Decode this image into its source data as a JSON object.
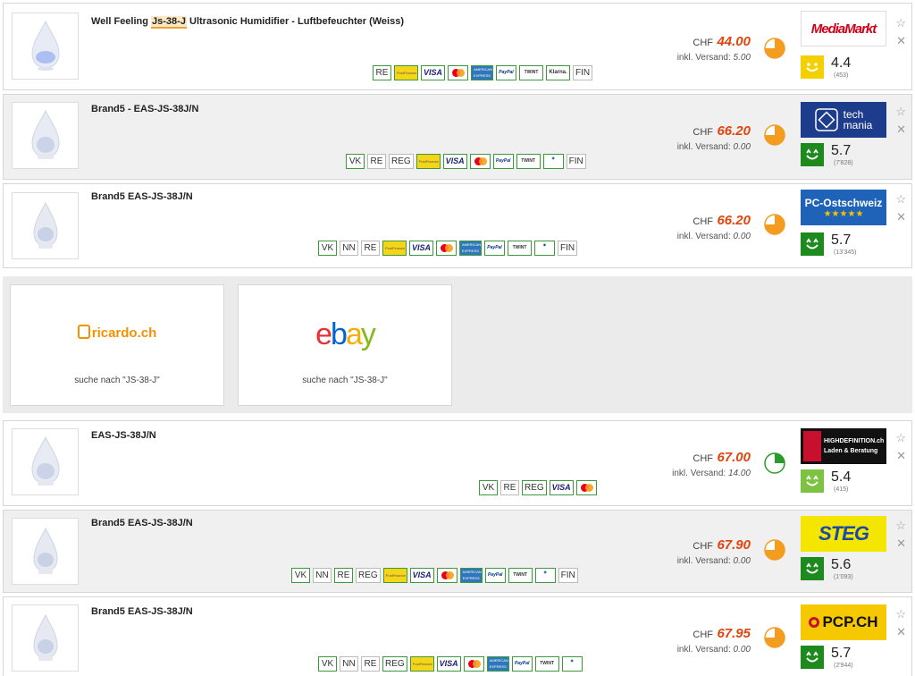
{
  "offers": [
    {
      "title_prefix": "Well Feeling ",
      "title_highlight": "Js-38-J",
      "title_suffix": " Ultrasonic Humidifier - Luftbefeuchter (Weiss)",
      "currency": "CHF",
      "price": "44.00",
      "shipping_label": "inkl. Versand:",
      "shipping": "5.00",
      "availability_icon": "availability-pie-icon",
      "badges": [
        "RE",
        "PF",
        "VISA",
        "MC",
        "AMEX",
        "PayPal",
        "TWINT",
        "Klarna.",
        "FIN"
      ],
      "shop_logo": "MediaMarkt",
      "rating": "4.4",
      "rating_count": "(453)",
      "rating_color": "#f5d000"
    },
    {
      "title": "Brand5 - EAS-JS-38J/N",
      "currency": "CHF",
      "price": "66.20",
      "shipping_label": "inkl. Versand:",
      "shipping": "0.00",
      "availability_icon": "availability-pie-icon",
      "badges": [
        "VK",
        "RE",
        "REG",
        "PF",
        "VISA",
        "MC",
        "PayPal",
        "TWINT",
        "DC",
        "FIN"
      ],
      "shop_logo_line1": "tech",
      "shop_logo_line2": "mania",
      "rating": "5.7",
      "rating_count": "(7'828)",
      "rating_color": "#1e8a1e"
    },
    {
      "title": "Brand5 EAS-JS-38J/N",
      "currency": "CHF",
      "price": "66.20",
      "shipping_label": "inkl. Versand:",
      "shipping": "0.00",
      "availability_icon": "availability-pie-icon",
      "badges": [
        "VK",
        "NN",
        "RE",
        "PF",
        "VISA",
        "MC",
        "AMEX",
        "PayPal",
        "TWINT",
        "DC",
        "FIN"
      ],
      "shop_logo": "PC-Ostschweiz",
      "shop_logo_stars": "★★★★★",
      "rating": "5.7",
      "rating_count": "(13'345)",
      "rating_color": "#1e8a1e"
    },
    {
      "title": "EAS-JS-38J/N",
      "currency": "CHF",
      "price": "67.00",
      "shipping_label": "inkl. Versand:",
      "shipping": "14.00",
      "availability_icon": "availability-pie-icon",
      "badges": [
        "VK",
        "RE",
        "REG",
        "VISA",
        "MC"
      ],
      "shop_logo_line1": "HIGHDEFINITION.ch",
      "shop_logo_line2": "Laden & Beratung",
      "rating": "5.4",
      "rating_count": "(415)",
      "rating_color": "#7dc242"
    },
    {
      "title": "Brand5 EAS-JS-38J/N",
      "currency": "CHF",
      "price": "67.90",
      "shipping_label": "inkl. Versand:",
      "shipping": "0.00",
      "availability_icon": "availability-pie-icon",
      "badges": [
        "VK",
        "NN",
        "RE",
        "REG",
        "PF",
        "VISA",
        "MC",
        "AMEX",
        "PayPal",
        "TWINT",
        "DC",
        "FIN"
      ],
      "shop_logo": "STEG",
      "rating": "5.6",
      "rating_count": "(1'093)",
      "rating_color": "#1e8a1e"
    },
    {
      "title": "Brand5 EAS-JS-38J/N",
      "currency": "CHF",
      "price": "67.95",
      "shipping_label": "inkl. Versand:",
      "shipping": "0.00",
      "availability_icon": "availability-pie-icon",
      "badges": [
        "VK",
        "NN",
        "RE",
        "REG",
        "PF",
        "VISA",
        "MC",
        "AMEX",
        "PayPal",
        "TWINT",
        "DC"
      ],
      "shop_logo": "PCP.CH",
      "rating": "5.7",
      "rating_count": "(2'944)",
      "rating_color": "#1e8a1e"
    }
  ],
  "external": {
    "ricardo": {
      "logo": "ricardo.ch",
      "search": "suche nach \"JS-38-J\""
    },
    "ebay": {
      "logo_e": "e",
      "logo_b": "b",
      "logo_a": "a",
      "logo_y": "y",
      "search": "suche nach \"JS-38-J\""
    }
  },
  "icons": {
    "favorite": "☆",
    "remove": "✕"
  },
  "colors": {
    "price": "#e0450d",
    "availability_orange": "#f39c1f",
    "availability_green": "#2a9a2a",
    "payment_border": "#3c9a3c"
  }
}
